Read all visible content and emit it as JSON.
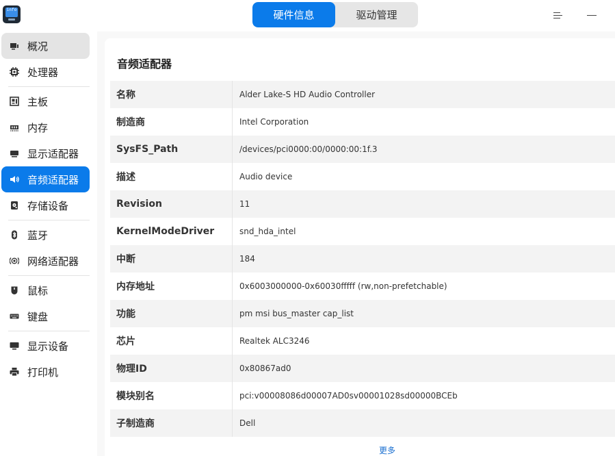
{
  "app": {
    "icon_text": "info"
  },
  "tabs": [
    {
      "label": "硬件信息",
      "active": true
    },
    {
      "label": "驱动管理",
      "active": false
    }
  ],
  "window_controls": {
    "menu_icon": "menu-icon",
    "minimize_icon": "minimize-icon"
  },
  "sidebar": {
    "items": [
      {
        "label": "概况",
        "icon": "overview-icon"
      },
      {
        "label": "处理器",
        "icon": "cpu-icon"
      },
      {
        "label": "主板",
        "icon": "motherboard-icon"
      },
      {
        "label": "内存",
        "icon": "memory-icon"
      },
      {
        "label": "显示适配器",
        "icon": "display-adapter-icon"
      },
      {
        "label": "音频适配器",
        "icon": "speaker-icon",
        "active": true
      },
      {
        "label": "存储设备",
        "icon": "storage-icon"
      },
      {
        "label": "蓝牙",
        "icon": "bluetooth-icon"
      },
      {
        "label": "网络适配器",
        "icon": "network-icon"
      },
      {
        "label": "鼠标",
        "icon": "mouse-icon"
      },
      {
        "label": "键盘",
        "icon": "keyboard-icon"
      },
      {
        "label": "显示设备",
        "icon": "monitor-icon"
      },
      {
        "label": "打印机",
        "icon": "printer-icon"
      }
    ]
  },
  "main": {
    "title": "音频适配器",
    "rows": [
      {
        "key": "名称",
        "value": "Alder Lake-S HD Audio Controller"
      },
      {
        "key": "制造商",
        "value": "Intel Corporation"
      },
      {
        "key": "SysFS_Path",
        "value": "/devices/pci0000:00/0000:00:1f.3"
      },
      {
        "key": "描述",
        "value": "Audio device"
      },
      {
        "key": "Revision",
        "value": "11"
      },
      {
        "key": "KernelModeDriver",
        "value": "snd_hda_intel"
      },
      {
        "key": "中断",
        "value": "184"
      },
      {
        "key": "内存地址",
        "value": "0x6003000000-0x60030fffff (rw,non-prefetchable)"
      },
      {
        "key": "功能",
        "value": "pm msi bus_master cap_list"
      },
      {
        "key": "芯片",
        "value": "Realtek ALC3246"
      },
      {
        "key": "物理ID",
        "value": "0x80867ad0"
      },
      {
        "key": "模块别名",
        "value": "pci:v00008086d00007AD0sv00001028sd00000BCEb"
      },
      {
        "key": "子制造商",
        "value": "Dell"
      }
    ],
    "more_label": "更多"
  },
  "colors": {
    "accent": "#0b7bea",
    "link": "#1a6fd0"
  }
}
